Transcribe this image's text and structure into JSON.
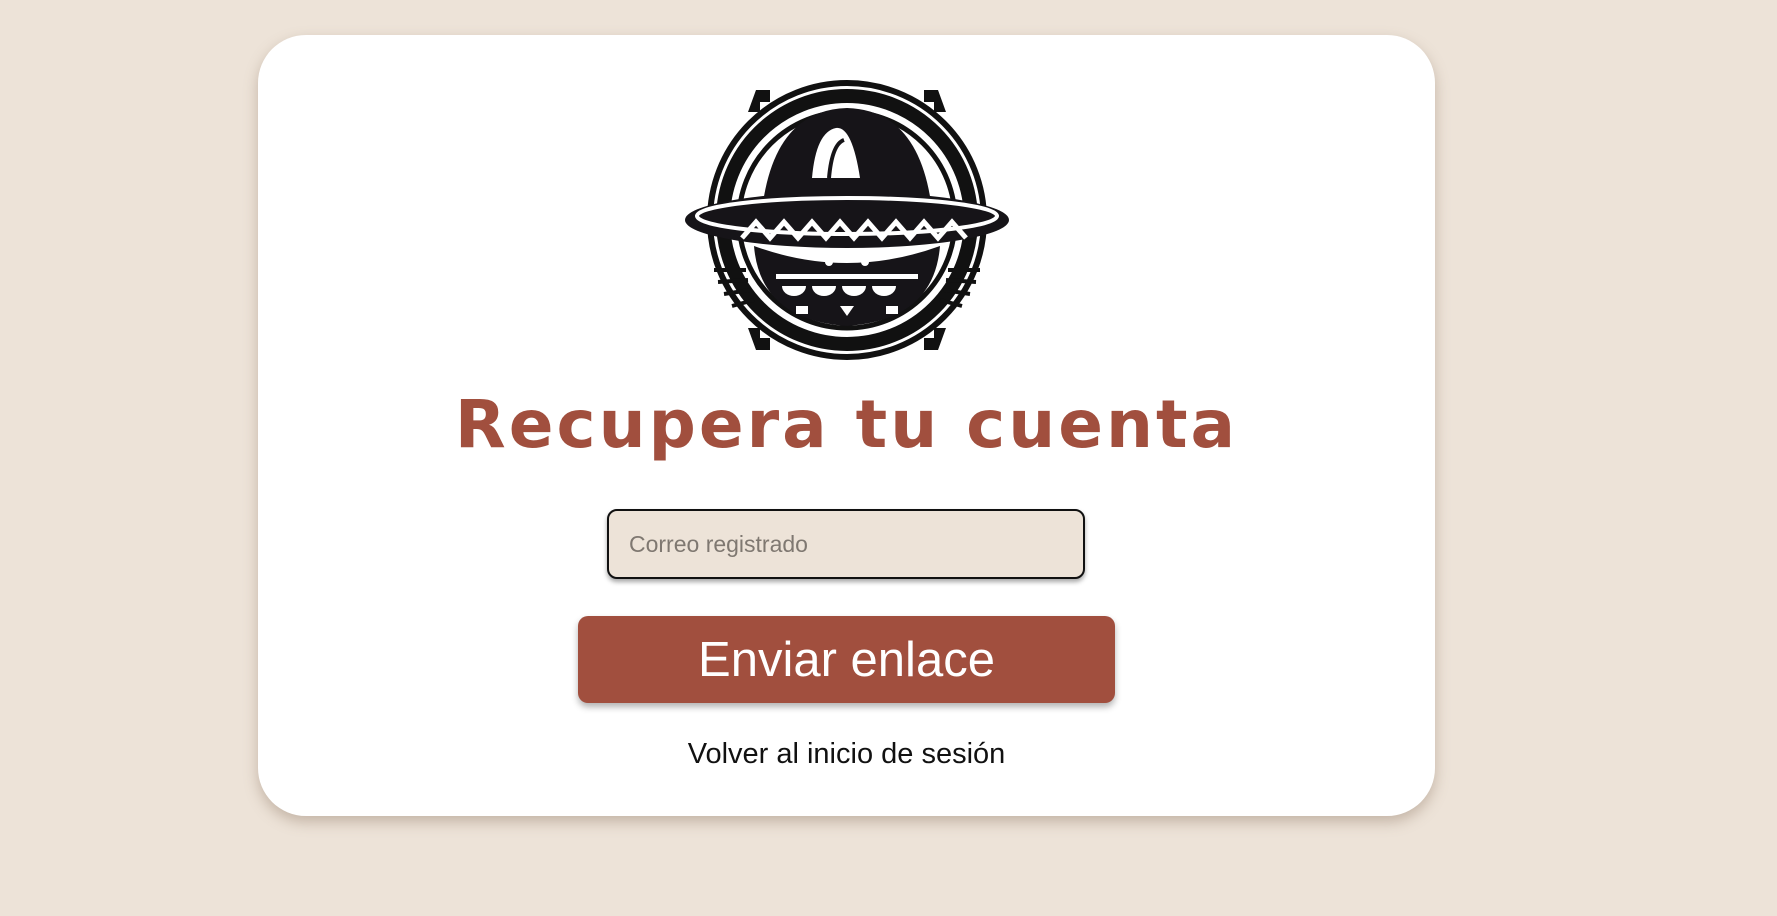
{
  "recovery": {
    "title": "Recupera tu cuenta",
    "email_placeholder": "Correo registrado",
    "email_value": "",
    "send_label": "Enviar enlace",
    "back_link": "Volver al inicio de sesión"
  },
  "colors": {
    "background": "#ede3d8",
    "card": "#ffffff",
    "accent": "#a14f3e",
    "input_background": "#ede3d8"
  },
  "logo": {
    "icon": "sombrero-icon"
  }
}
